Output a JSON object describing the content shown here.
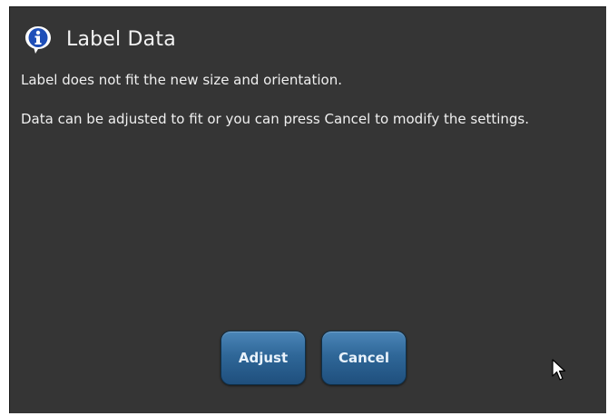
{
  "dialog": {
    "title": "Label Data",
    "title_icon": "info-icon",
    "message_line1": "Label does not fit the new size and orientation.",
    "message_line2": "Data can be adjusted to fit or you can press Cancel to modify the settings."
  },
  "buttons": {
    "adjust_label": "Adjust",
    "cancel_label": "Cancel"
  },
  "colors": {
    "dialog_background": "#353535",
    "button_blue": "#2f6798",
    "text": "#f0f0f0"
  },
  "cursor_icon": "mouse-pointer-icon"
}
